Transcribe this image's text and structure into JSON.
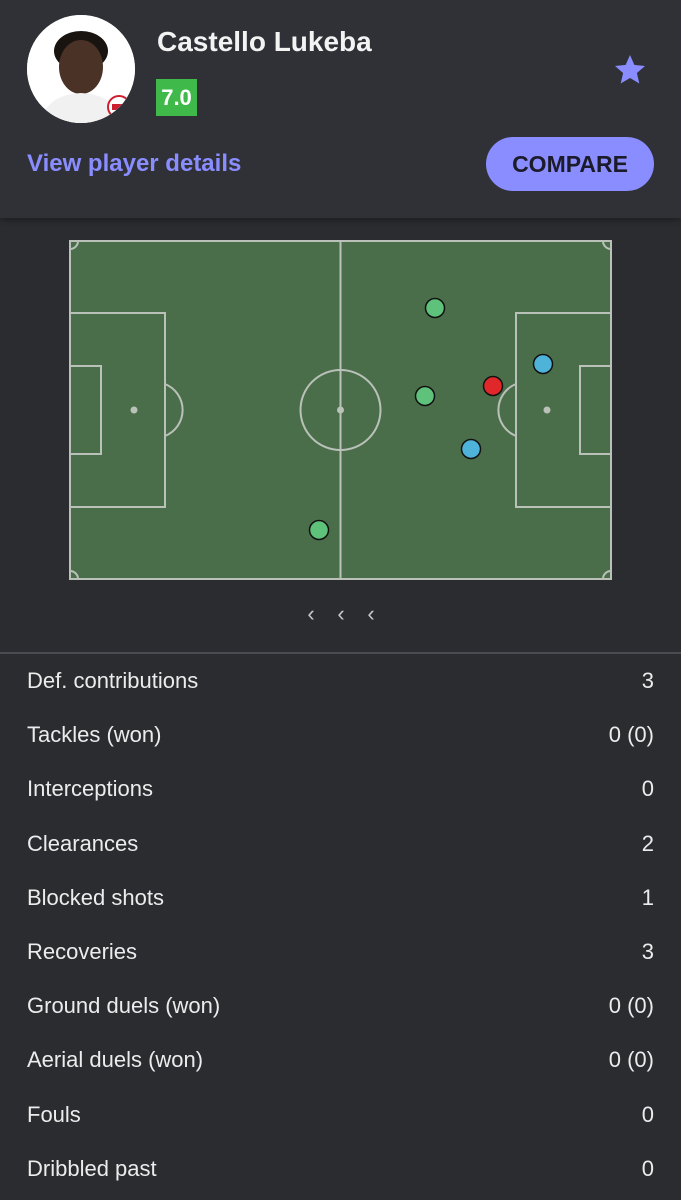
{
  "player": {
    "name": "Castello Lukeba",
    "rating": "7.0",
    "view_details_label": "View player details",
    "compare_label": "COMPARE",
    "favorite_icon": "star-icon"
  },
  "colors": {
    "accent": "#8a8dff",
    "rating_bg": "#3fba4a",
    "pitch": "#4b6e4a",
    "dot_green": "#5fc27a",
    "dot_blue": "#4fb3d9",
    "dot_red": "#e0282a"
  },
  "heatmap_nav": {
    "icon": "chevron-left-icon",
    "glyph": "‹"
  },
  "stats": [
    {
      "label": "Def. contributions",
      "value": "3"
    },
    {
      "label": "Tackles (won)",
      "value": "0 (0)"
    },
    {
      "label": "Interceptions",
      "value": "0"
    },
    {
      "label": "Clearances",
      "value": "2"
    },
    {
      "label": "Blocked shots",
      "value": "1"
    },
    {
      "label": "Recoveries",
      "value": "3"
    },
    {
      "label": "Ground duels (won)",
      "value": "0 (0)"
    },
    {
      "label": "Aerial duels (won)",
      "value": "0 (0)"
    },
    {
      "label": "Fouls",
      "value": "0"
    },
    {
      "label": "Dribbled past",
      "value": "0"
    }
  ]
}
